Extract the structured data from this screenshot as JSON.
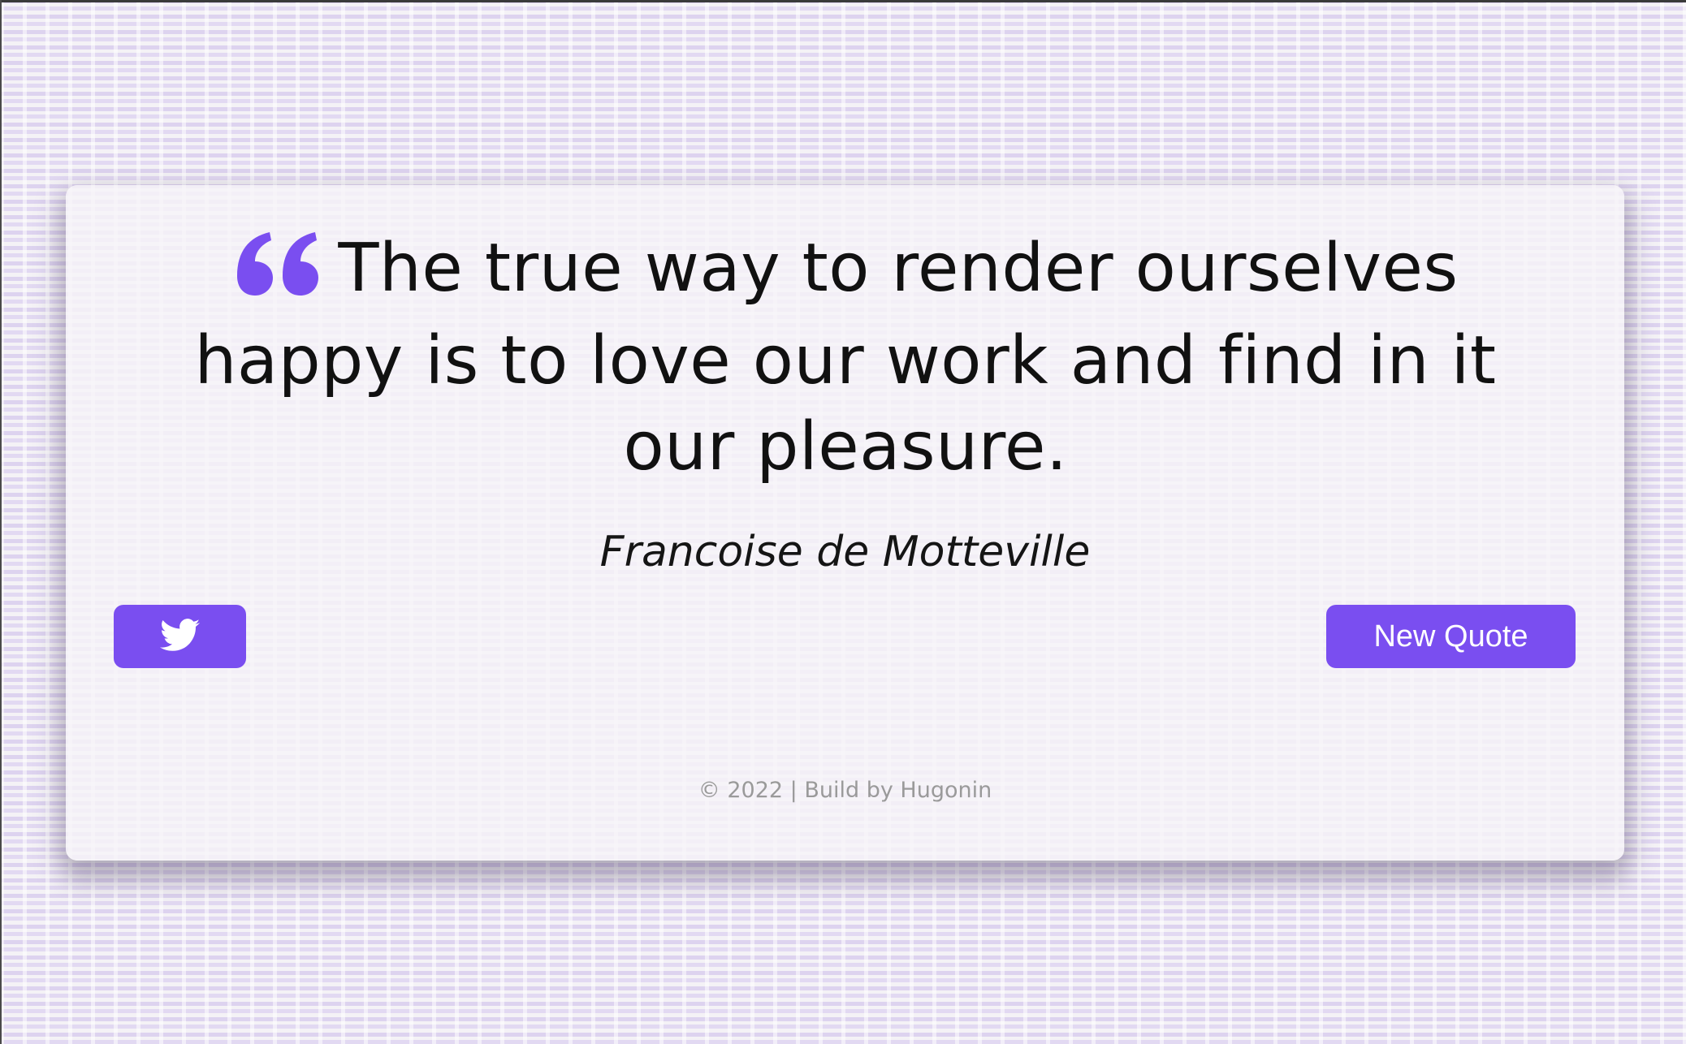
{
  "quote": {
    "text": "The true way to render ourselves happy is to love our work and find in it our pleasure.",
    "author": "Francoise de Motteville",
    "icon": "quote-left-icon"
  },
  "actions": {
    "tweet_icon": "twitter-icon",
    "new_quote_label": "New Quote"
  },
  "footer": {
    "text": "© 2022 | Build by Hugonin"
  },
  "colors": {
    "accent": "#7a4ef0",
    "text": "#111111",
    "footer": "#9a9a9a"
  }
}
